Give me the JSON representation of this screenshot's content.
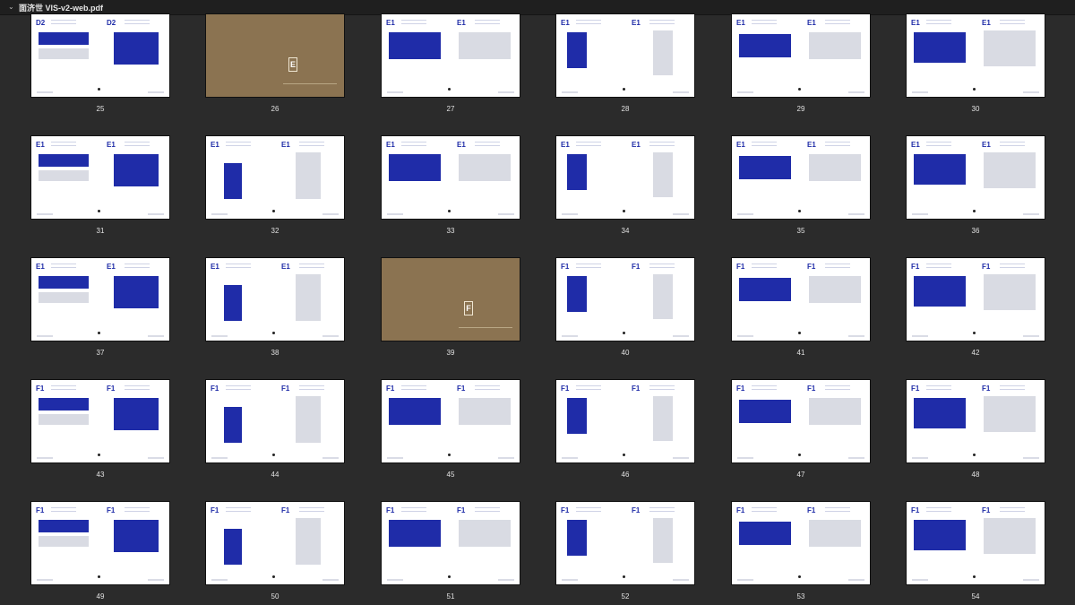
{
  "window": {
    "title": "面济世 VIS-v2-web.pdf"
  },
  "colors": {
    "brand_blue": "#1f2ca8",
    "section_brown": "#8b7351",
    "background": "#2b2b2b"
  },
  "pages": [
    {
      "number": "25",
      "code": "D2"
    },
    {
      "number": "26",
      "section_letter": "E"
    },
    {
      "number": "27",
      "code": "E1"
    },
    {
      "number": "28",
      "code": "E1"
    },
    {
      "number": "29",
      "code": "E1"
    },
    {
      "number": "30",
      "code": "E1"
    },
    {
      "number": "31",
      "code": "E1"
    },
    {
      "number": "32",
      "code": "E1"
    },
    {
      "number": "33",
      "code": "E1"
    },
    {
      "number": "34",
      "code": "E1"
    },
    {
      "number": "35",
      "code": "E1"
    },
    {
      "number": "36",
      "code": "E1"
    },
    {
      "number": "37",
      "code": "E1"
    },
    {
      "number": "38",
      "code": "E1"
    },
    {
      "number": "39",
      "section_letter": "F"
    },
    {
      "number": "40",
      "code": "F1"
    },
    {
      "number": "41",
      "code": "F1"
    },
    {
      "number": "42",
      "code": "F1"
    },
    {
      "number": "43",
      "code": "F1"
    },
    {
      "number": "44",
      "code": "F1"
    },
    {
      "number": "45",
      "code": "F1"
    },
    {
      "number": "46",
      "code": "F1"
    },
    {
      "number": "47",
      "code": "F1"
    },
    {
      "number": "48",
      "code": "F1"
    },
    {
      "number": "49",
      "code": "F1"
    },
    {
      "number": "50",
      "code": "F1"
    },
    {
      "number": "51",
      "code": "F1"
    },
    {
      "number": "52",
      "code": "F1"
    },
    {
      "number": "53",
      "code": "F1"
    },
    {
      "number": "54",
      "code": "F1"
    }
  ]
}
